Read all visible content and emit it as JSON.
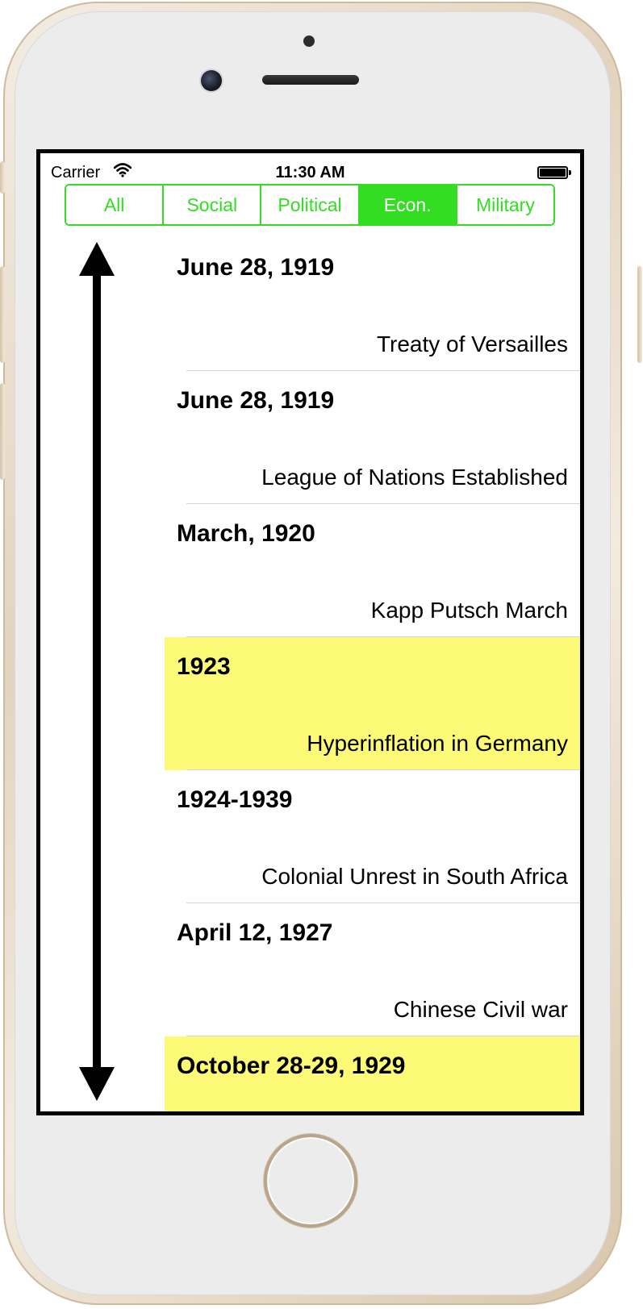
{
  "status_bar": {
    "carrier": "Carrier",
    "time": "11:30 AM"
  },
  "segmented_control": {
    "segments": [
      "All",
      "Social",
      "Political",
      "Econ.",
      "Military"
    ],
    "selected": "Econ.",
    "tint_color": "#33dd22"
  },
  "timeline": {
    "highlight_color": "#fdfa78",
    "events": [
      {
        "date": "June 28, 1919",
        "title": "Treaty of Versailles",
        "highlighted": false
      },
      {
        "date": "June 28, 1919",
        "title": "League of Nations Established",
        "highlighted": false
      },
      {
        "date": "March, 1920",
        "title": "Kapp Putsch March",
        "highlighted": false
      },
      {
        "date": "1923",
        "title": "Hyperinflation in Germany",
        "highlighted": true
      },
      {
        "date": "1924-1939",
        "title": "Colonial Unrest in South Africa",
        "highlighted": false
      },
      {
        "date": "April 12, 1927",
        "title": "Chinese Civil war",
        "highlighted": false
      },
      {
        "date": "October 28-29, 1929",
        "title": "",
        "highlighted": true
      }
    ]
  }
}
